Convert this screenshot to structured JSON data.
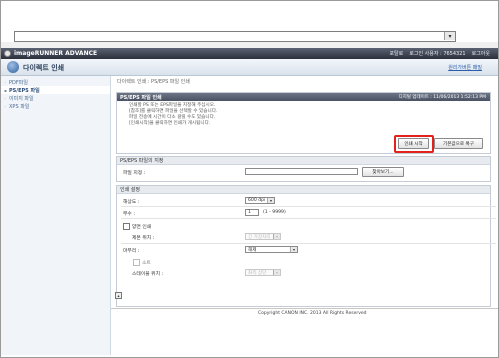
{
  "header": {
    "brand": "imageRUNNER ADVANCE",
    "right_items": [
      "포탈로",
      "로그인 사용자 : 7654321",
      "로그아웃"
    ]
  },
  "titlebar": {
    "app_name": "다이렉트 인쇄",
    "right_link": "원리가버튼 패밀"
  },
  "sidebar": {
    "items": [
      {
        "label": "PDF파일",
        "active": false
      },
      {
        "label": "PS/EPS 파일",
        "active": true
      },
      {
        "label": "이미지 파일",
        "active": false
      },
      {
        "label": "XPS 파일",
        "active": false
      }
    ]
  },
  "breadcrumb": "다이렉트 인쇄 : PS/EPS 파일 인쇄",
  "panel": {
    "title": "PS/EPS 파일 인쇄",
    "updated": "디지털 업데이트 : 11/06/2013 1:52:13 PM",
    "messages": [
      "인쇄할 PS 또는 EPS파일을 지정해 주십시오.",
      "[참조]를 클릭하면 파일을 선택할 수 있습니다.",
      "파일 전송에 시간이 다소 걸릴 수도 있습니다.",
      "[인쇄시작]을 클릭하면 인쇄가 개시됩니다."
    ],
    "start_button": "인쇄 시작",
    "restore_button": "기본값으로 복구"
  },
  "file_section": {
    "title": "PS/EPS 파일의 지정",
    "label": "파일 지정 :",
    "value": "",
    "browse_button": "찾아보기..."
  },
  "print_settings": {
    "title": "인쇄 설정",
    "resolution_label": "해상도 :",
    "resolution_value": "600 dpi",
    "copies_label": "부수 :",
    "copies_value": "1",
    "copies_range": "(1 - 9999)",
    "duplex_label": "양면 인쇄",
    "binding_label": "제본 위치 :",
    "binding_value": "긴 가장자리",
    "finishing_label": "마무리 :",
    "finishing_value": "해제",
    "sort_label": "소트",
    "staple_label": "스테이플 위치 :",
    "staple_value": "좌측 상단"
  },
  "footer": {
    "copyright": "Copyright CANON INC. 2013 All Rights Reserved"
  }
}
